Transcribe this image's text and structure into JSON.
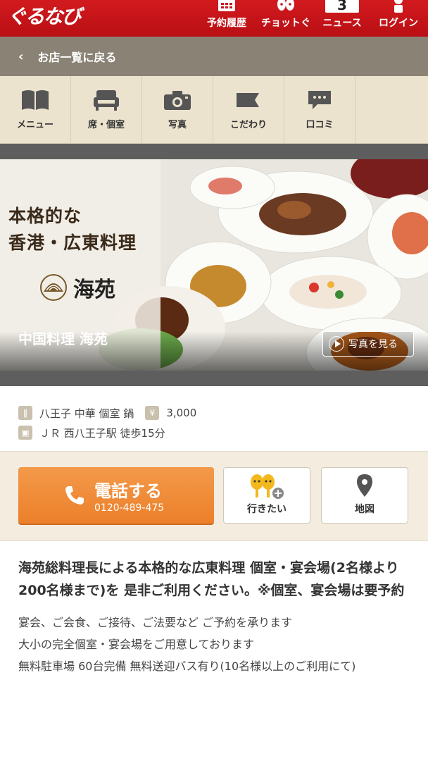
{
  "header": {
    "logo": "ぐるなび",
    "nav": [
      {
        "label": "予約履歴",
        "icon": "calendar-icon"
      },
      {
        "label": "チョットぐ",
        "icon": "mascot-icon"
      },
      {
        "label": "ニュース",
        "icon": "news-badge",
        "badge": "3"
      },
      {
        "label": "ログイン",
        "icon": "person-icon"
      }
    ],
    "colors": {
      "bg": "#c8151a"
    }
  },
  "back": {
    "label": "お店一覧に戻る"
  },
  "tabs": [
    {
      "label": "メニュー",
      "icon": "book-icon"
    },
    {
      "label": "席・個室",
      "icon": "sofa-icon"
    },
    {
      "label": "写真",
      "icon": "camera-icon"
    },
    {
      "label": "こだわり",
      "icon": "flag-icon"
    },
    {
      "label": "口コミ",
      "icon": "speech-bubble-icon"
    }
  ],
  "hero": {
    "tagline_line1": "本格的な",
    "tagline_line2": "香港・広東料理",
    "brand_name": "海苑",
    "restaurant_name": "中国料理 海苑",
    "photo_button": "写真を見る"
  },
  "info": {
    "genre": "八王子 中華 個室 鍋",
    "budget": "3,000",
    "access": "ＪＲ 西八王子駅 徒歩15分"
  },
  "actions": {
    "call_label": "電話する",
    "call_number": "0120-489-475",
    "want_label": "行きたい",
    "map_label": "地図",
    "colors": {
      "call": "#f08a36"
    }
  },
  "description": {
    "title": "海苑総料理長による本格的な広東料理 個室・宴会場(2名様より200名様まで)を 是非ご利用ください。※個室、宴会場は要予約",
    "body_line1": "宴会、ご会食、ご接待、ご法要など ご予約を承ります",
    "body_line2": "大小の完全個室・宴会場をご用意しております",
    "body_line3": "無料駐車場 60台完備 無料送迎バス有り(10名様以上のご利用にて)"
  }
}
